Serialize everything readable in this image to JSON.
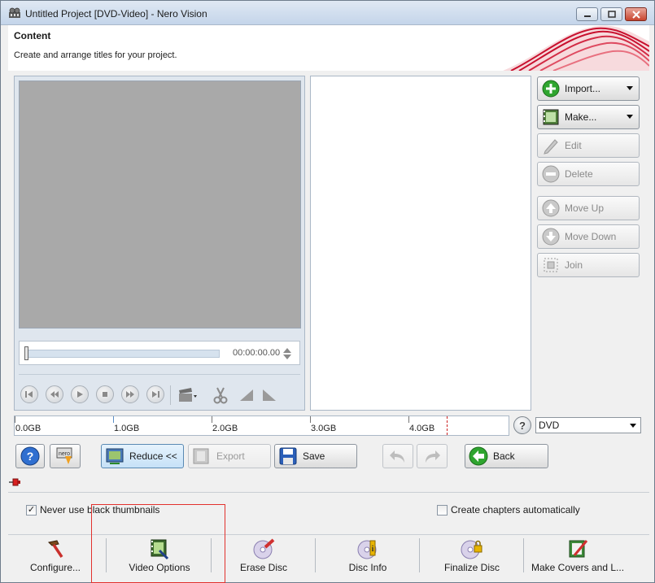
{
  "window": {
    "title": "Untitled Project [DVD-Video] - Nero Vision"
  },
  "header": {
    "title": "Content",
    "subtitle": "Create and arrange titles for your project."
  },
  "preview": {
    "time": "00:00:00.00"
  },
  "side_buttons": {
    "import": "Import...",
    "make": "Make...",
    "edit": "Edit",
    "delete": "Delete",
    "move_up": "Move Up",
    "move_down": "Move Down",
    "join": "Join"
  },
  "capacity": {
    "labels": [
      "0.0GB",
      "1.0GB",
      "2.0GB",
      "3.0GB",
      "4.0GB"
    ],
    "disc_type": "DVD"
  },
  "toolbar": {
    "reduce": "Reduce <<",
    "export": "Export",
    "save": "Save",
    "back": "Back"
  },
  "options": {
    "never_black_thumbnails": {
      "label": "Never use black thumbnails",
      "checked": true
    },
    "create_chapters": {
      "label": "Create chapters automatically",
      "checked": false
    }
  },
  "bottom": {
    "configure": "Configure...",
    "video_options": "Video Options",
    "erase_disc": "Erase Disc",
    "disc_info": "Disc Info",
    "finalize_disc": "Finalize Disc",
    "make_covers": "Make Covers and L..."
  },
  "colors": {
    "accent_red": "#c8102e",
    "highlight": "#e2312d",
    "active_blue": "#c6e1f7"
  }
}
